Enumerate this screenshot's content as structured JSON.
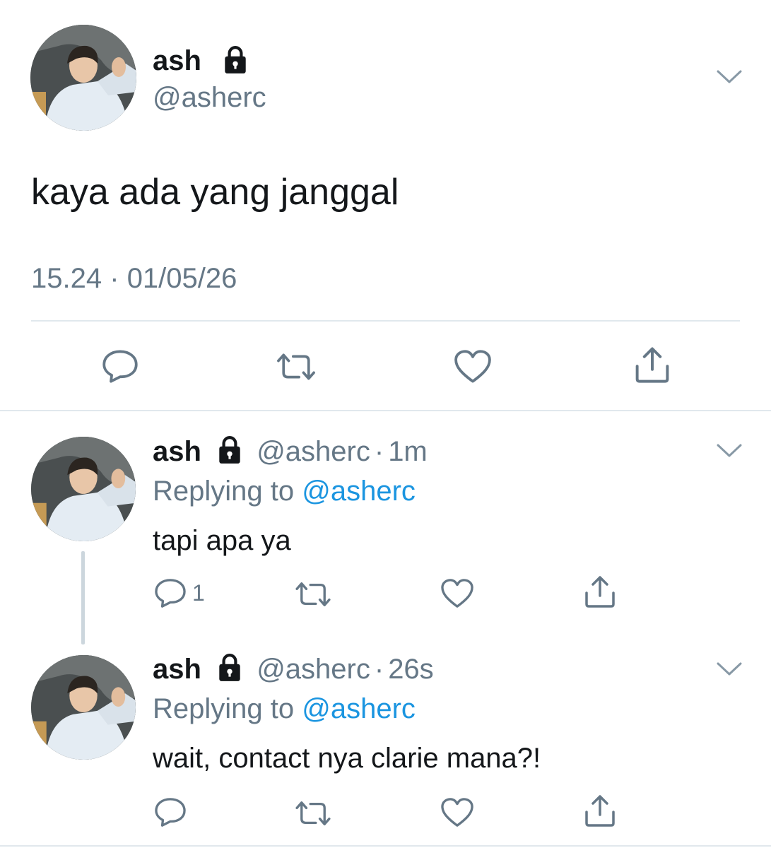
{
  "main_tweet": {
    "display_name": "ash",
    "handle": "@asherc",
    "text": "kaya ada yang janggal",
    "time": "15.24",
    "separator": "·",
    "date": "01/05/26",
    "icons": {
      "lock": "lock-icon",
      "more": "chevron-down-icon",
      "reply": "reply-icon",
      "retweet": "retweet-icon",
      "like": "heart-icon",
      "share": "share-icon"
    }
  },
  "replies": [
    {
      "display_name": "ash",
      "handle": "@asherc",
      "separator": "·",
      "time_ago": "1m",
      "replying_label": "Replying to",
      "replying_to": "@asherc",
      "text": "tapi apa ya",
      "reply_count": "1"
    },
    {
      "display_name": "ash",
      "handle": "@asherc",
      "separator": "·",
      "time_ago": "26s",
      "replying_label": "Replying to",
      "replying_to": "@asherc",
      "text": "wait, contact nya clarie mana?!",
      "reply_count": ""
    }
  ],
  "colors": {
    "text": "#14171a",
    "secondary": "#657786",
    "link": "#1b95e0",
    "divider": "#e1e8ed",
    "thread": "#ccd6dd"
  }
}
